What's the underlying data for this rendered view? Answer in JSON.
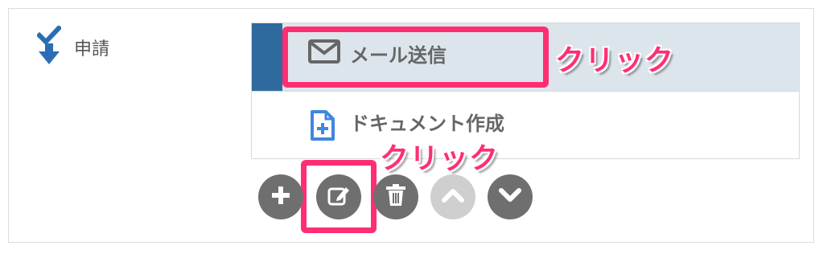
{
  "step": {
    "label": "申請",
    "icon": "download-check-icon"
  },
  "items": [
    {
      "label": "メール送信",
      "icon": "envelope-icon",
      "selected": true
    },
    {
      "label": "ドキュメント作成",
      "icon": "document-plus-icon",
      "selected": false
    }
  ],
  "callouts": [
    "クリック",
    "クリック"
  ],
  "toolbar": [
    {
      "icon": "plus-icon",
      "enabled": true
    },
    {
      "icon": "edit-icon",
      "enabled": true
    },
    {
      "icon": "trash-icon",
      "enabled": true
    },
    {
      "icon": "chevron-up-icon",
      "enabled": false
    },
    {
      "icon": "chevron-down-icon",
      "enabled": true
    }
  ],
  "colors": {
    "accent_blue": "#2e6a9e",
    "selected_row": "#dde5ec",
    "highlight": "#ff2e72",
    "button_dark": "#6f6f6f",
    "button_disabled": "#cfcfcf",
    "step_icon": "#2a6db5"
  }
}
